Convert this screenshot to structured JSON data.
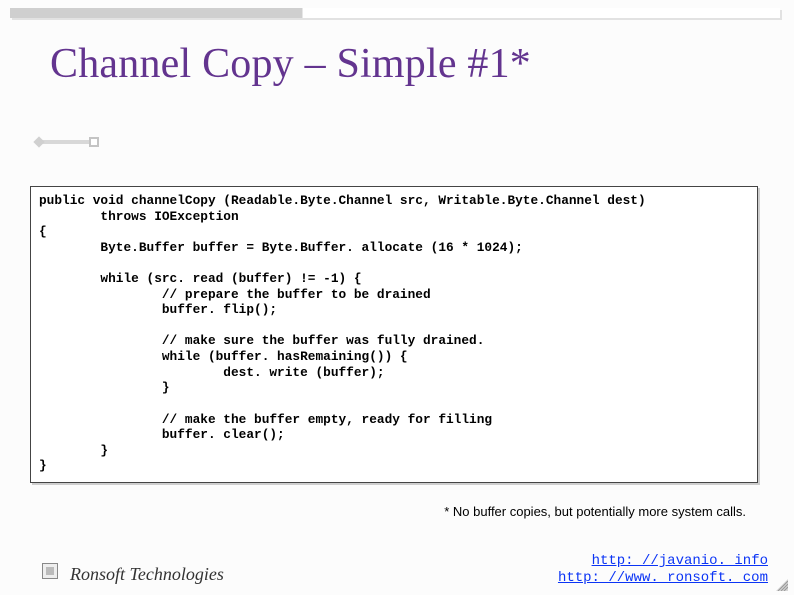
{
  "title": "Channel Copy – Simple #1*",
  "code": "public void channelCopy (Readable.Byte.Channel src, Writable.Byte.Channel dest)\n        throws IOException\n{\n        Byte.Buffer buffer = Byte.Buffer. allocate (16 * 1024);\n\n        while (src. read (buffer) != -1) {\n                // prepare the buffer to be drained\n                buffer. flip();\n\n                // make sure the buffer was fully drained.\n                while (buffer. hasRemaining()) {\n                        dest. write (buffer);\n                }\n\n                // make the buffer empty, ready for filling\n                buffer. clear();\n        }\n}",
  "footnote": "* No buffer copies, but potentially more system calls.",
  "footer": {
    "company": "Ronsoft Technologies",
    "link1_text": "http: //javanio. info",
    "link1_href": "http://javanio.info",
    "link2_text": "http: //www. ronsoft. com",
    "link2_href": "http://www.ronsoft.com"
  }
}
